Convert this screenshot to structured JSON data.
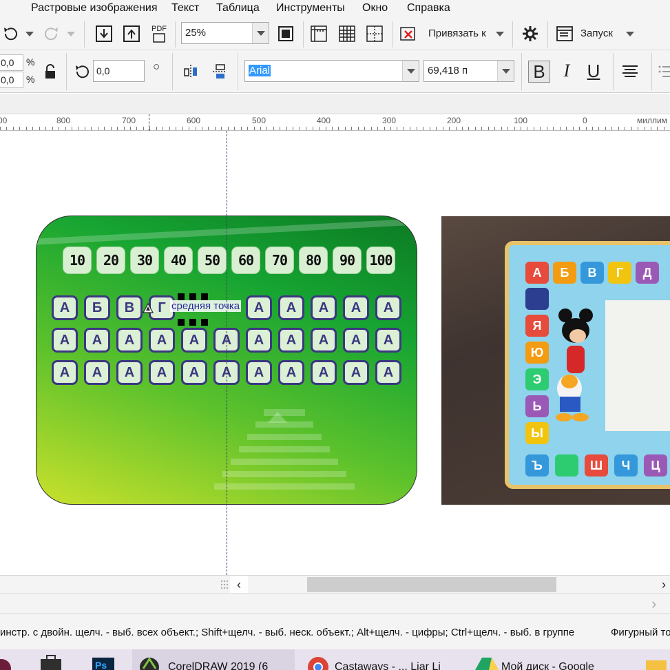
{
  "menu": {
    "items": [
      "Растровые изображения",
      "Текст",
      "Таблица",
      "Инструменты",
      "Окно",
      "Справка"
    ]
  },
  "toolbar": {
    "pdf_label": "PDF",
    "zoom_value": "25%",
    "snap_label": "Привязать к",
    "launch_label": "Запуск"
  },
  "property_bar": {
    "pos_x": "0,0",
    "pos_y": "0,0",
    "percent_symbol": "%",
    "rotation_value": "0,0",
    "degree_symbol": "○",
    "font_name": "Arial",
    "font_size": "69,418 п",
    "bold_label": "B",
    "italic_label": "I",
    "underline_label": "U"
  },
  "ruler": {
    "labels": [
      "00",
      "800",
      "700",
      "600",
      "500",
      "400",
      "300",
      "200",
      "100",
      "0",
      "миллим"
    ]
  },
  "card": {
    "numbers": [
      "10",
      "20",
      "30",
      "40",
      "50",
      "60",
      "70",
      "80",
      "90",
      "100"
    ],
    "rows": [
      [
        "А",
        "Б",
        "В",
        "Г",
        "",
        "",
        "А",
        "А",
        "А",
        "А",
        "А"
      ],
      [
        "А",
        "А",
        "А",
        "А",
        "А",
        "А",
        "А",
        "А",
        "А",
        "А",
        "А"
      ],
      [
        "А",
        "А",
        "А",
        "А",
        "А",
        "А",
        "А",
        "А",
        "А",
        "А",
        "А"
      ]
    ]
  },
  "snap_tooltip": "средняя точка",
  "photo_board": {
    "top_letters": [
      "А",
      "Б",
      "В",
      "Г",
      "Д"
    ],
    "side_letters": [
      "",
      "Я",
      "Ю",
      "Э",
      "Ь",
      "Ы"
    ],
    "bottom_letters": [
      "Ъ",
      "",
      "Ш",
      "Ч",
      "Ц"
    ]
  },
  "status": {
    "hint": "инстр. с двойн. щелч. - выб. всех объект.; Shift+щелч. - выб. неск. объект.; Alt+щелч. - цифры; Ctrl+щелч. - выб. в группе",
    "right_text": "Фигурный то"
  },
  "taskbar": {
    "coreldraw": "CorelDRAW 2019 (6",
    "chrome": "Castaways - ... Liar Li",
    "drive": "Мой диск - Google"
  },
  "colors": {
    "accent_selection": "#3399ff",
    "tile_border": "#3a3780",
    "card_dark": "#0b7a24",
    "card_light": "#c9e12c"
  }
}
